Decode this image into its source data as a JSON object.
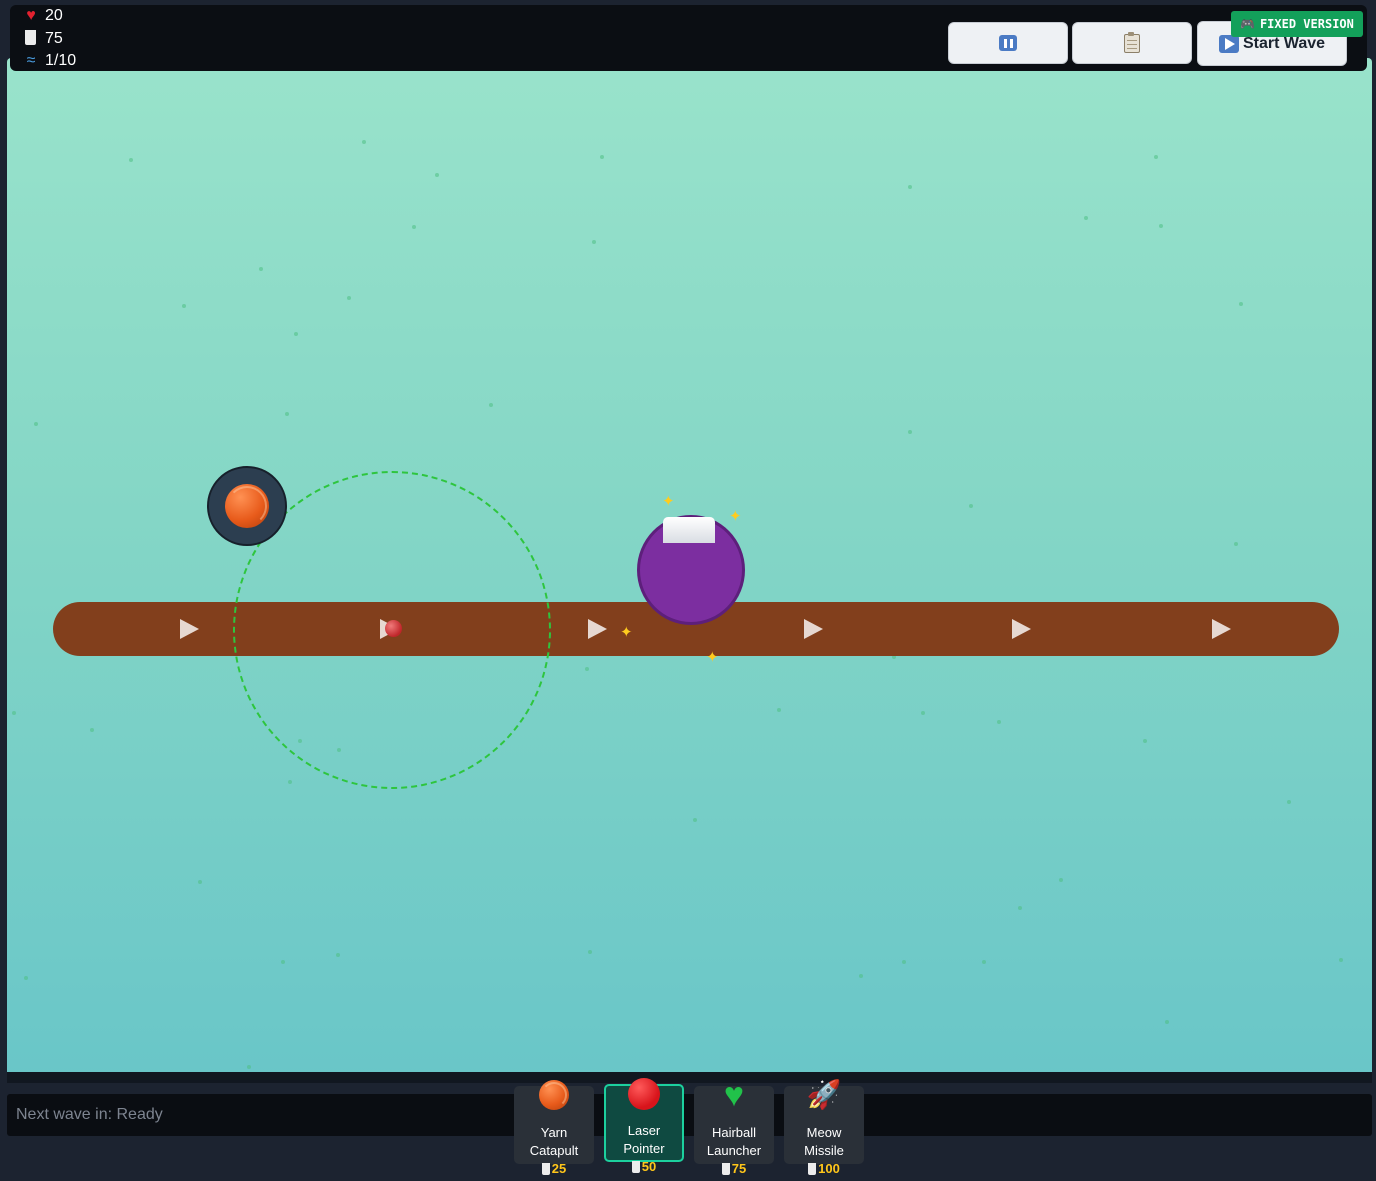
{
  "topbar": {
    "lives": "20",
    "lives_icon": "heart-icon",
    "milk": "75",
    "milk_icon": "milk-cup-icon",
    "wave": "1/10",
    "wave_icon": "wave-icon"
  },
  "controls": {
    "pause_icon": "pause-icon",
    "log_icon": "clipboard-icon",
    "start_label": "Start Wave",
    "start_icon": "play-icon"
  },
  "badge": {
    "label": "FIXED VERSION",
    "icon": "game-controller-icon"
  },
  "status": {
    "next_wave": "Next wave in: Ready"
  },
  "shop": [
    {
      "name_line1": "Yarn",
      "name_line2": "Catapult",
      "cost": "25",
      "icon": "yarn-ball-icon",
      "selected": false
    },
    {
      "name_line1": "Laser",
      "name_line2": "Pointer",
      "cost": "50",
      "icon": "red-circle-icon",
      "selected": true
    },
    {
      "name_line1": "Hairball",
      "name_line2": "Launcher",
      "cost": "75",
      "icon": "green-heart-icon",
      "selected": false
    },
    {
      "name_line1": "Meow",
      "name_line2": "Missile",
      "cost": "100",
      "icon": "rocket-icon",
      "selected": false
    }
  ],
  "colors": {
    "path": "#823f1c",
    "field_top": "#99e3cb",
    "field_bottom": "#69c6c8",
    "range_ring": "#2ec53e",
    "enemy": "#7c2ea0",
    "selected_border": "#1cd09e",
    "cost": "#ffc61a",
    "badge": "#13a05a"
  }
}
